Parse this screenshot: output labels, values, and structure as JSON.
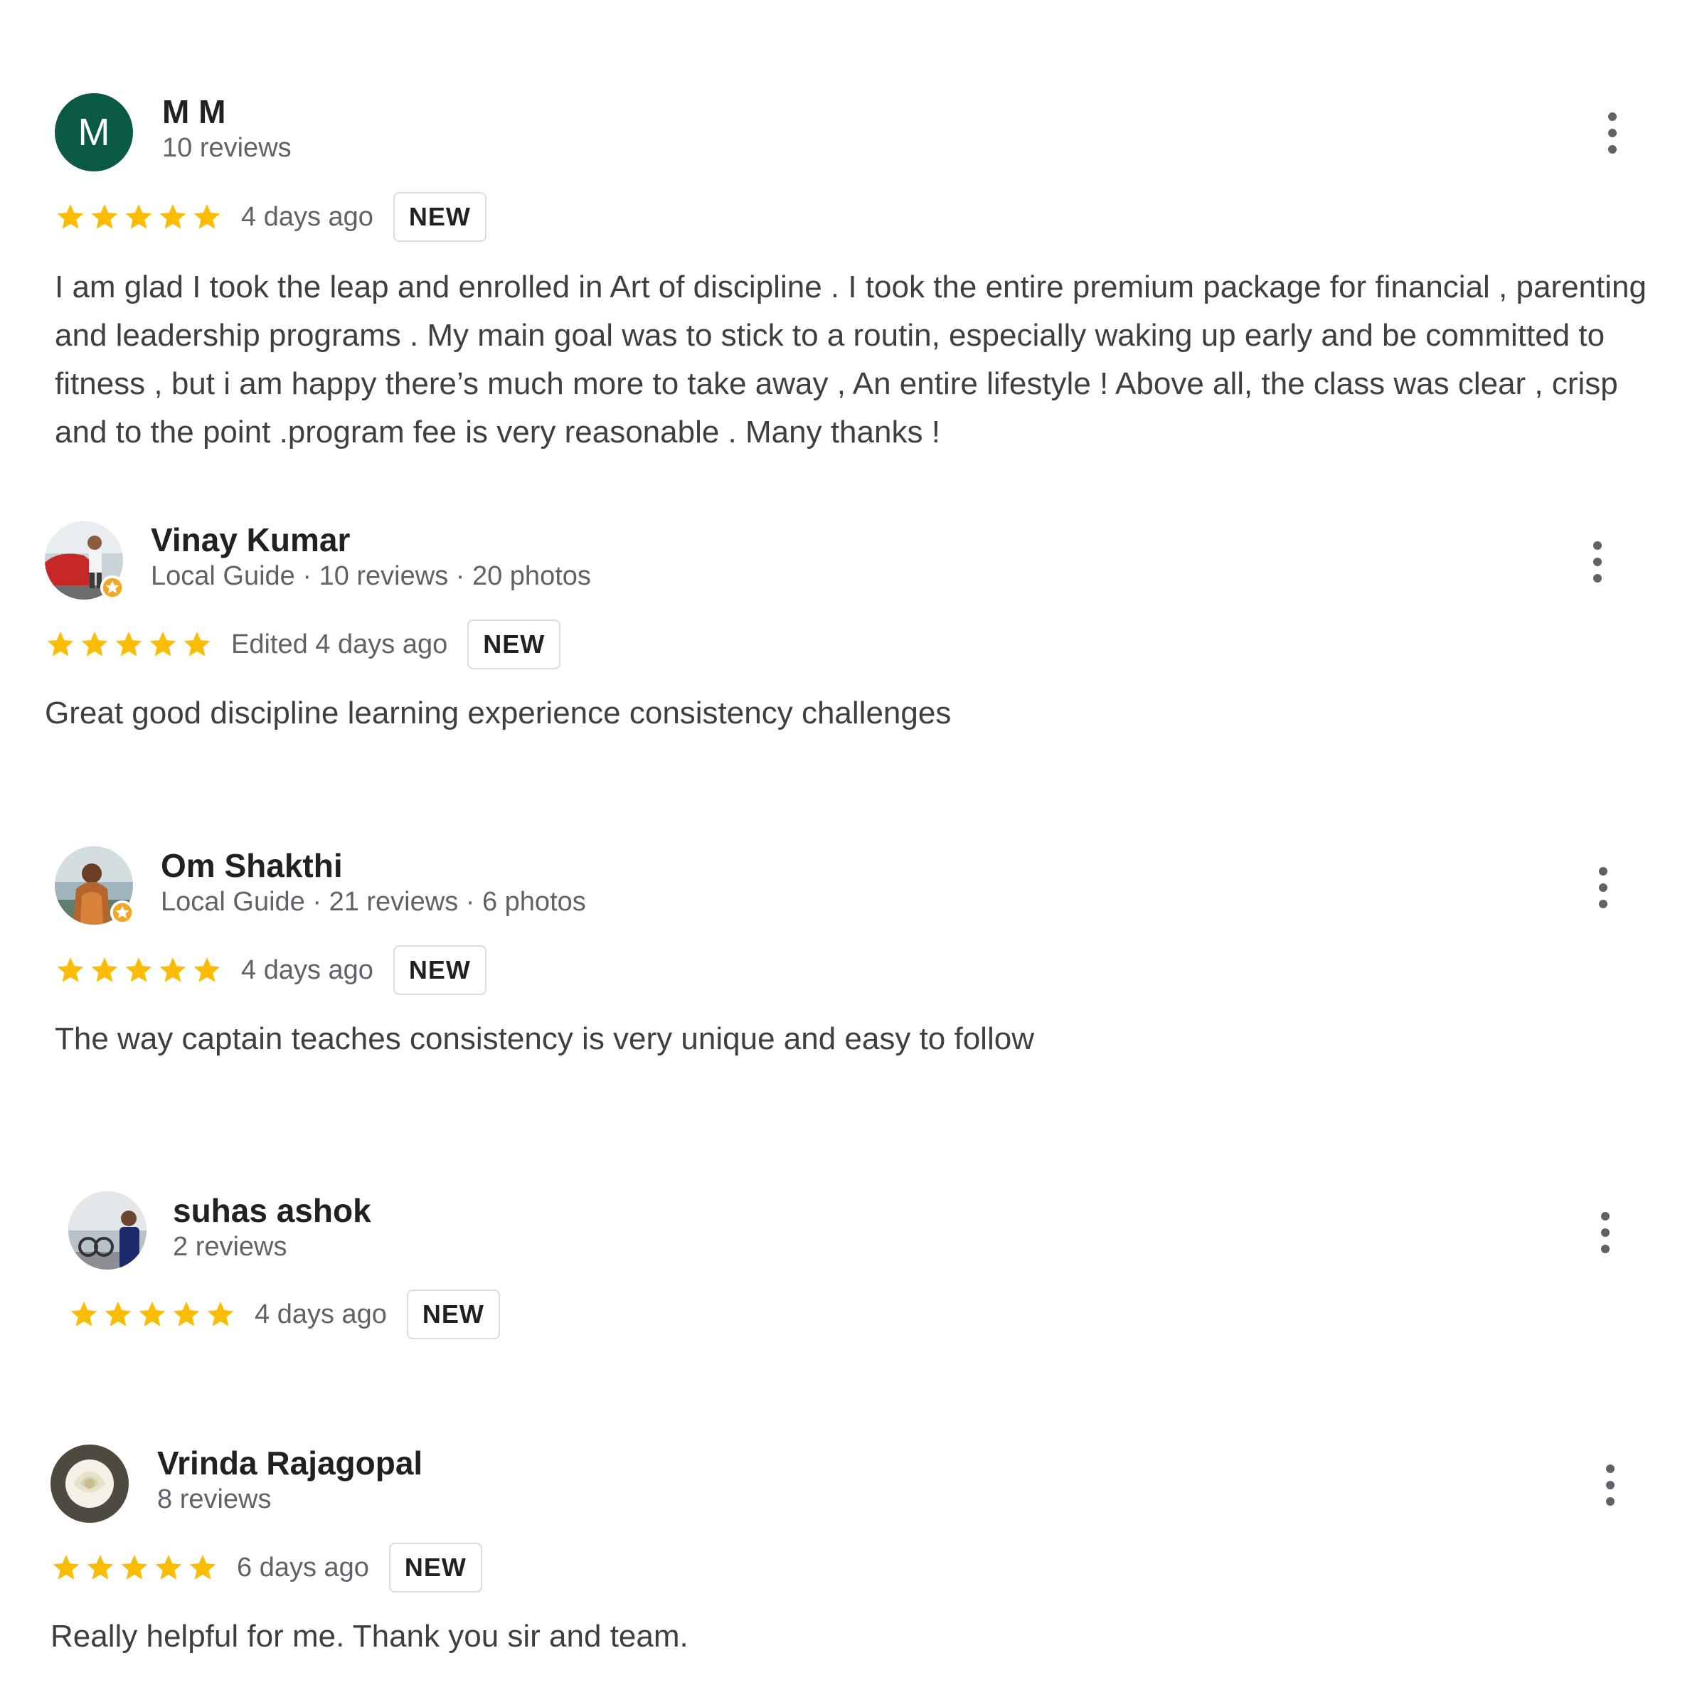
{
  "colors": {
    "star": "#fbbc04",
    "badge_border": "#dadce0",
    "secondary_text": "#5f6368",
    "body_text": "#3c4043",
    "mm_avatar_bg": "#0b5a45"
  },
  "reviews": [
    {
      "name": "M M",
      "meta": "10 reviews",
      "avatar_letter": "M",
      "rating": 5,
      "date": "4 days ago",
      "badge": "NEW",
      "text": "I am glad I took the leap and enrolled in Art of discipline . I took the entire premium package for financial , parenting and leadership programs . My main goal was to stick to a routin, especially waking up early and be committed to fitness , but i am happy there’s much more to take away , An entire lifestyle ! Above all, the class was clear , crisp and to the point .program fee is very reasonable . Many thanks !"
    },
    {
      "name": "Vinay Kumar",
      "meta": "Local Guide · 10 reviews · 20 photos",
      "rating": 5,
      "date": "Edited 4 days ago",
      "badge": "NEW",
      "text": "Great good discipline learning experience consistency challenges"
    },
    {
      "name": "Om Shakthi",
      "meta": "Local Guide · 21 reviews · 6 photos",
      "rating": 5,
      "date": "4 days ago",
      "badge": "NEW",
      "text": "The way captain teaches consistency is very unique and easy to follow"
    },
    {
      "name": "suhas ashok",
      "meta": "2 reviews",
      "rating": 5,
      "date": "4 days ago",
      "badge": "NEW",
      "text": ""
    },
    {
      "name": "Vrinda Rajagopal",
      "meta": "8 reviews",
      "rating": 5,
      "date": "6 days ago",
      "badge": "NEW",
      "text": "Really helpful for me. Thank you sir and team."
    }
  ]
}
